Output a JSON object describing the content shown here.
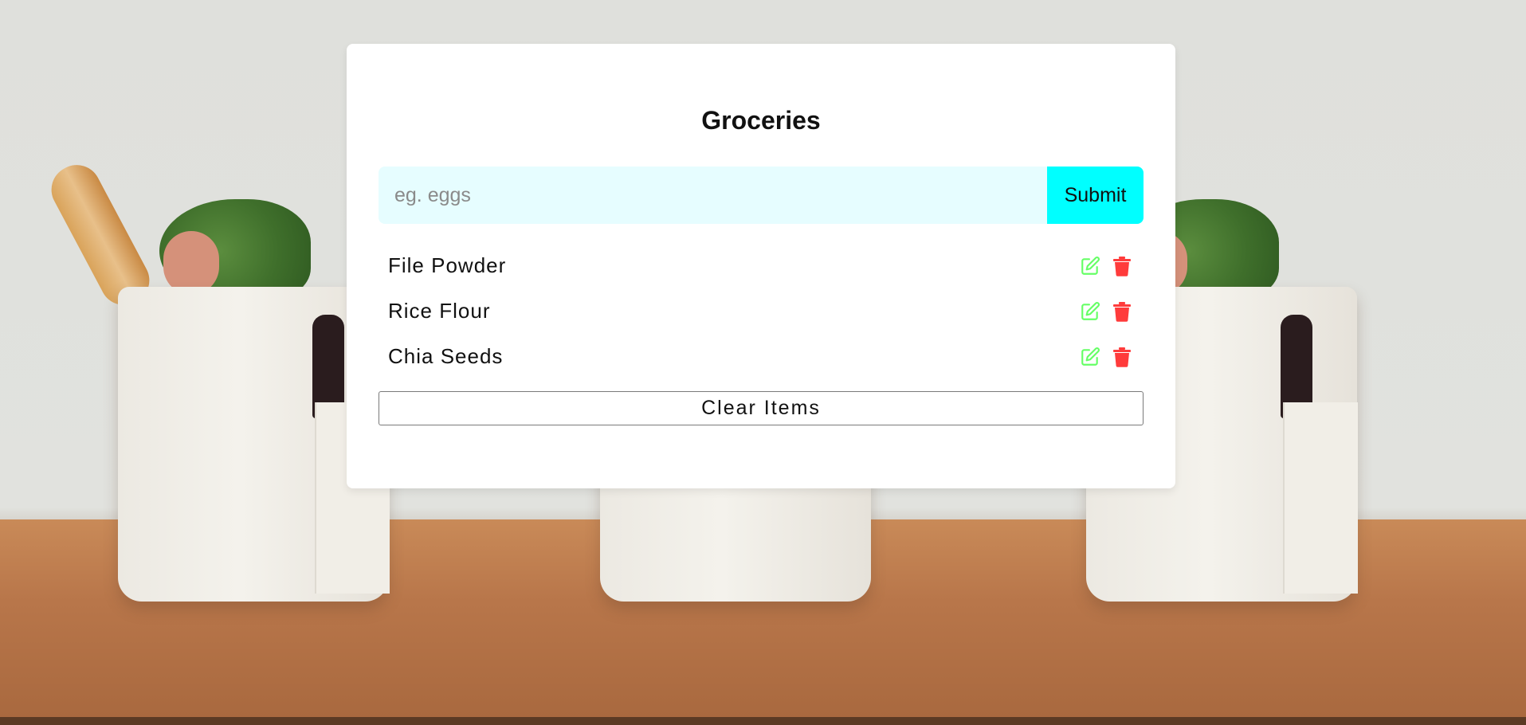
{
  "app": {
    "title": "Groceries"
  },
  "form": {
    "placeholder": "eg. eggs",
    "value": "",
    "submit_label": "Submit"
  },
  "items": [
    {
      "label": "File Powder"
    },
    {
      "label": "Rice Flour"
    },
    {
      "label": "Chia Seeds"
    }
  ],
  "actions": {
    "clear_label": "Clear Items"
  },
  "colors": {
    "submit_bg": "#00ffff",
    "input_bg": "#e6fdff",
    "edit_icon": "#66ff66",
    "delete_icon": "#ff3b3b"
  },
  "icons": {
    "edit": "edit-icon",
    "delete": "trash-icon"
  }
}
